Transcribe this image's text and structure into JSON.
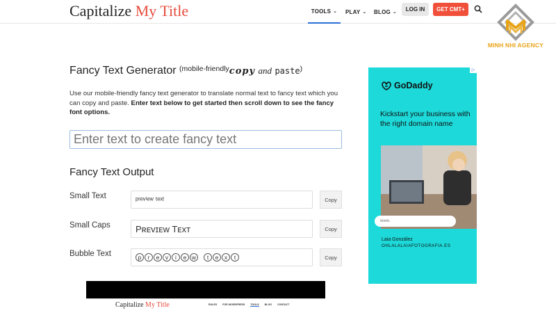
{
  "header": {
    "logo_main": "Capitalize ",
    "logo_accent": "My Title",
    "nav": [
      {
        "label": "TOOLS",
        "active": true
      },
      {
        "label": "PLAY",
        "active": false
      },
      {
        "label": "BLOG",
        "active": false
      }
    ],
    "login_label": "LOG IN",
    "get_label": "GET CMT+"
  },
  "watermark": {
    "text": "MINH NHI AGENCY"
  },
  "main": {
    "title": "Fancy Text Generator",
    "title_paren_open": "(mobile-friendly",
    "title_fancy1": "copy",
    "title_fancy2": "and",
    "title_fancy3": "paste",
    "title_paren_close": ")",
    "intro_plain": "Use our mobile-friendly fancy text generator to translate normal text to fancy text which you can copy and paste. ",
    "intro_bold": "Enter text below to get started then scroll down to see the fancy font options.",
    "input_placeholder": "Enter text to create fancy text",
    "output_title": "Fancy Text Output",
    "rows": [
      {
        "label": "Small Text",
        "value": "ᵖʳᵉᵛⁱᵉʷ ᵗᵉˣᵗ",
        "copy": "Copy"
      },
      {
        "label": "Small Caps",
        "value": "Pʀᴇᴠɪᴇᴡ Tᴇxᴛ",
        "copy": "Copy"
      },
      {
        "label": "Bubble Text",
        "bubbles": [
          "p",
          "r",
          "e",
          "v",
          "i",
          "e",
          "w",
          " ",
          "t",
          "e",
          "x",
          "t"
        ],
        "copy": "Copy"
      }
    ]
  },
  "video": {
    "logo_main": "Capitalize ",
    "logo_accent": "My Title",
    "nav": [
      "RULES",
      "FOR WORDPRESS",
      "TOOLS",
      "BLOG",
      "CONTACT"
    ]
  },
  "ad": {
    "brand": "GoDaddy",
    "headline": "Kickstart your business with the right domain name",
    "search_text": "www.",
    "person_name": "Laia González",
    "site": "OHLALALAIAFOTOGRAFIA.ES",
    "bg_color": "#1dd9d9"
  }
}
